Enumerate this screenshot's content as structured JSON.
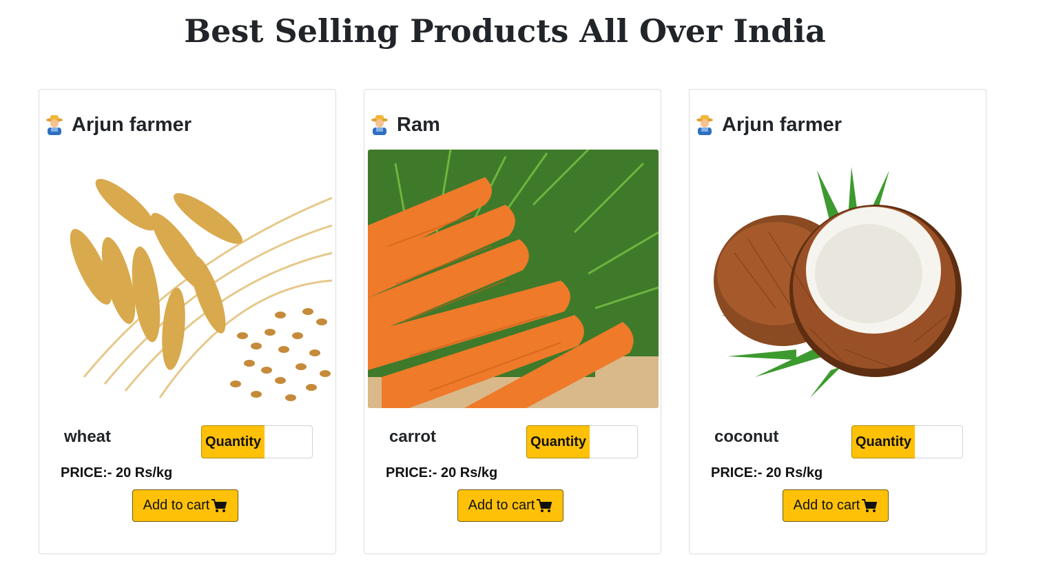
{
  "page": {
    "title": "Best Selling Products All Over India"
  },
  "products": [
    {
      "farmer": "Arjun farmer",
      "farmer_icon": "farmer-icon",
      "image_subject": "wheat",
      "name": "wheat",
      "quantity_label": "Quantity",
      "quantity_value": "",
      "price": "PRICE:- 20 Rs/kg",
      "add_to_cart_label": "Add to cart",
      "cart_icon": "shopping-cart-icon"
    },
    {
      "farmer": "Ram",
      "farmer_icon": "farmer-icon",
      "image_subject": "carrot",
      "name": "carrot",
      "quantity_label": "Quantity",
      "quantity_value": "",
      "price": "PRICE:- 20 Rs/kg",
      "add_to_cart_label": "Add to cart",
      "cart_icon": "shopping-cart-icon"
    },
    {
      "farmer": "Arjun farmer",
      "farmer_icon": "farmer-icon",
      "image_subject": "coconut",
      "name": "coconut",
      "quantity_label": "Quantity",
      "quantity_value": "",
      "price": "PRICE:- 20 Rs/kg",
      "add_to_cart_label": "Add to cart",
      "cart_icon": "shopping-cart-icon"
    }
  ],
  "colors": {
    "accent": "#ffc107",
    "text": "#212529",
    "card_border": "#dcdcdc"
  }
}
